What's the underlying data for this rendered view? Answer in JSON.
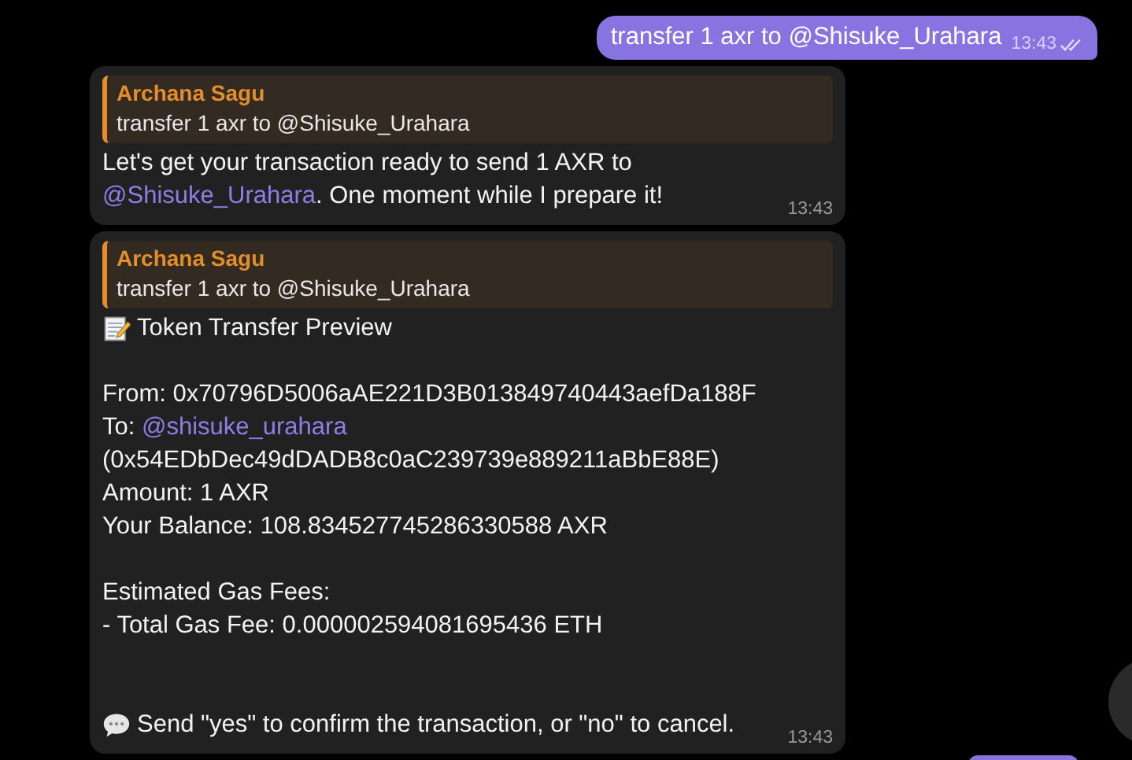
{
  "messages": [
    {
      "kind": "outgoing",
      "text": "transfer 1 axr to @Shisuke_Urahara",
      "time": "13:43",
      "read": true
    },
    {
      "kind": "incoming",
      "quote": {
        "author": "Archana Sagu",
        "text": "transfer 1 axr to @Shisuke_Urahara"
      },
      "time": "13:43",
      "paragraphs": [
        {
          "kind": "lead",
          "lines": [
            {
              "kind": "text",
              "segments": [
                {
                  "kind": "text",
                  "text": "Let's get your transaction ready to send 1 AXR to "
                },
                {
                  "kind": "mention",
                  "text": "@Shisuke_Urahara"
                },
                {
                  "kind": "text",
                  "text": ". One moment while I prepare it!"
                }
              ]
            }
          ]
        }
      ]
    },
    {
      "kind": "incoming",
      "quote": {
        "author": "Archana Sagu",
        "text": "transfer 1 axr to @Shisuke_Urahara"
      },
      "time": "13:43",
      "paragraphs": [
        {
          "kind": "lead",
          "lines": [
            {
              "kind": "memo",
              "segments": [
                {
                  "kind": "text",
                  "text": "Token Transfer Preview"
                }
              ]
            }
          ]
        },
        {
          "kind": "body",
          "lines": [
            {
              "kind": "text",
              "segments": [
                {
                  "kind": "text",
                  "text": "From: 0x70796D5006aAE221D3B013849740443aefDa188F"
                }
              ]
            },
            {
              "kind": "text",
              "segments": [
                {
                  "kind": "text",
                  "text": "To: "
                },
                {
                  "kind": "mention",
                  "text": "@shisuke_urahara"
                }
              ]
            },
            {
              "kind": "text",
              "segments": [
                {
                  "kind": "text",
                  "text": "(0x54EDbDec49dDADB8c0aC239739e889211aBbE88E)"
                }
              ]
            },
            {
              "kind": "text",
              "segments": [
                {
                  "kind": "text",
                  "text": "Amount: 1 AXR"
                }
              ]
            },
            {
              "kind": "text",
              "segments": [
                {
                  "kind": "text",
                  "text": "Your Balance: 108.834527745286330588 AXR"
                }
              ]
            }
          ]
        },
        {
          "kind": "body",
          "lines": [
            {
              "kind": "text",
              "segments": [
                {
                  "kind": "text",
                  "text": "Estimated Gas Fees:"
                }
              ]
            },
            {
              "kind": "text",
              "segments": [
                {
                  "kind": "text",
                  "text": "- Total Gas Fee: 0.000002594081695436 ETH"
                }
              ]
            }
          ]
        },
        {
          "kind": "closing",
          "lines": [
            {
              "kind": "speech",
              "segments": [
                {
                  "kind": "text",
                  "text": "Send \"yes\" to confirm the transaction, or \"no\" to cancel."
                }
              ]
            }
          ]
        }
      ]
    }
  ]
}
